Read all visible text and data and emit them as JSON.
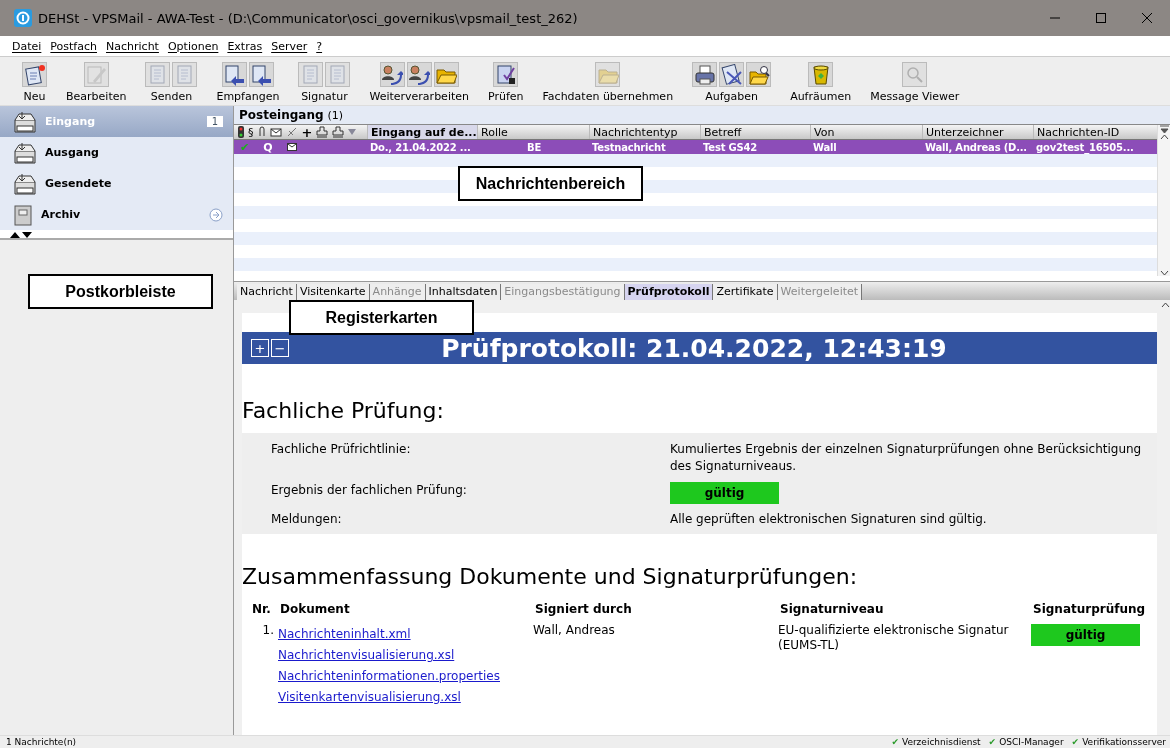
{
  "window": {
    "title": "DEHSt - VPSMail - AWA-Test - (D:\\Communicator\\osci_governikus\\vpsmail_test_262)"
  },
  "menu": [
    "Datei",
    "Postfach",
    "Nachricht",
    "Optionen",
    "Extras",
    "Server",
    "?"
  ],
  "toolbar": [
    {
      "label": "Neu",
      "disabled": false
    },
    {
      "label": "Bearbeiten",
      "disabled": true
    },
    {
      "label": "Senden",
      "disabled": true
    },
    {
      "label": "Empfangen",
      "disabled": false
    },
    {
      "label": "Signatur",
      "disabled": true
    },
    {
      "label": "Weiterverarbeiten",
      "disabled": false
    },
    {
      "label": "Prüfen",
      "disabled": false
    },
    {
      "label": "Fachdaten übernehmen",
      "disabled": true
    },
    {
      "label": "Aufgaben",
      "disabled": false
    },
    {
      "label": "Aufräumen",
      "disabled": false
    },
    {
      "label": "Message Viewer",
      "disabled": true
    }
  ],
  "sidebar": {
    "items": [
      {
        "label": "Eingang",
        "kind": "mailbox",
        "selected": true,
        "badge": "1"
      },
      {
        "label": "Ausgang",
        "kind": "mailbox",
        "selected": false
      },
      {
        "label": "Gesendete",
        "kind": "mailbox",
        "selected": false
      },
      {
        "label": "Archiv",
        "kind": "archive",
        "selected": false
      }
    ]
  },
  "inbox": {
    "title": "Posteingang",
    "count": "(1)",
    "icon_column_labels": [
      "§",
      "+"
    ],
    "columns": [
      "Eingang auf de...",
      "Rolle",
      "Nachrichtentyp",
      "Betreff",
      "Von",
      "Unterzeichner",
      "Nachrichten-ID"
    ],
    "rows": [
      {
        "selected": true,
        "status": "✔",
        "flag": "Q",
        "cells": [
          "Do., 21.04.2022 ...",
          "BE",
          "Testnachricht",
          "Test GS42",
          "Wall",
          "Wall, Andreas (D...",
          "gov2test_16505..."
        ]
      }
    ]
  },
  "tabs": [
    {
      "label": "Nachricht",
      "selected": false,
      "disabled": false
    },
    {
      "label": "Visitenkarte",
      "selected": false,
      "disabled": false
    },
    {
      "label": "Anhänge",
      "selected": false,
      "disabled": true
    },
    {
      "label": "Inhaltsdaten",
      "selected": false,
      "disabled": false
    },
    {
      "label": "Eingangsbestätigung",
      "selected": false,
      "disabled": true
    },
    {
      "label": "Prüfprotokoll",
      "selected": true,
      "disabled": false
    },
    {
      "label": "Zertifikate",
      "selected": false,
      "disabled": false
    },
    {
      "label": "Weitergeleitet",
      "selected": false,
      "disabled": true
    }
  ],
  "report": {
    "expand": "+",
    "collapse": "−",
    "title": "Prüfprotokoll: 21.04.2022, 12:43:19",
    "section1": {
      "heading": "Fachliche Prüfung:",
      "rows": [
        {
          "label": "Fachliche Prüfrichtlinie:",
          "value": "Kumuliertes Ergebnis der einzelnen Signaturprüfungen ohne Berücksichtigung des Signaturniveaus.",
          "kind": "text"
        },
        {
          "label": "Ergebnis der fachlichen Prüfung:",
          "value": "gültig",
          "kind": "result"
        },
        {
          "label": "Meldungen:",
          "value": "Alle geprüften elektronischen Signaturen sind gültig.",
          "kind": "text"
        }
      ]
    },
    "section2": {
      "heading": "Zusammenfassung Dokumente und Signaturprüfungen:",
      "columns": [
        "Nr.",
        "Dokument",
        "Signiert durch",
        "Signaturniveau",
        "Signaturprüfung"
      ],
      "rows": [
        {
          "nr": "1.",
          "documents": [
            "Nachrichteninhalt.xml",
            "Nachrichtenvisualisierung.xsl",
            "Nachrichteninformationen.properties",
            "Visitenkartenvisualisierung.xsl"
          ],
          "signer": "Wall, Andreas",
          "level": "EU-qualifizierte elektronische Signatur (EUMS-TL)",
          "result": "gültig"
        }
      ]
    }
  },
  "annotations": [
    {
      "text": "Postkorbleiste",
      "kind": "sidebar"
    },
    {
      "text": "Nachrichtenbereich",
      "kind": "list"
    },
    {
      "text": "Registerkarten",
      "kind": "tabs"
    }
  ],
  "status_bar": {
    "left": "1 Nachrichte(n)",
    "services": [
      {
        "check": "✔",
        "label": "Verzeichnisdienst"
      },
      {
        "check": "✔",
        "label": "OSCI-Manager"
      },
      {
        "check": "✔",
        "label": "Verifikationsserver"
      }
    ]
  }
}
